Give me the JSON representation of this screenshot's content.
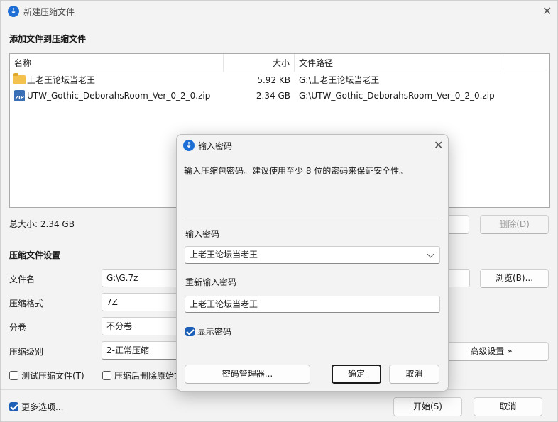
{
  "window": {
    "title": "新建压缩文件"
  },
  "files_section": {
    "title": "添加文件到压缩文件"
  },
  "file_list": {
    "columns": [
      "名称",
      "大小",
      "文件路径"
    ],
    "rows": [
      {
        "name": "上老王论坛当老王",
        "size": "5.92 KB",
        "path": "G:\\上老王论坛当老王",
        "icon": "folder-icon"
      },
      {
        "name": "UTW_Gothic_DeborahsRoom_Ver_0_2_0.zip",
        "size": "2.34 GB",
        "path": "G:\\UTW_Gothic_DeborahsRoom_Ver_0_2_0.zip",
        "icon": "zip-icon"
      }
    ]
  },
  "total_size": "总大小: 2.34 GB",
  "delete_button": "删除(D)",
  "settings": {
    "title": "压缩文件设置",
    "filename_label": "文件名",
    "filename_value": "G:\\G.7z",
    "browse_button": "浏览(B)...",
    "format_label": "压缩格式",
    "format_value": "7Z",
    "volume_label": "分卷",
    "volume_value": "不分卷",
    "level_label": "压缩级别",
    "level_value": "2-正常压缩",
    "advanced_button": "高级设置 »",
    "test_label": "测试压缩文件(T)",
    "delete_after_label": "压缩后删除原始文"
  },
  "footer": {
    "more_options": "更多选项...",
    "start_button": "开始(S)",
    "cancel_button": "取消"
  },
  "password_dialog": {
    "title": "输入密码",
    "description": "输入压缩包密码。建议使用至少 8 位的密码来保证安全性。",
    "password_label": "输入密码",
    "password_value": "上老王论坛当老王",
    "reenter_label": "重新输入密码",
    "reenter_value": "上老王论坛当老王",
    "show_password": "显示密码",
    "manager_button": "密码管理器...",
    "ok_button": "确定",
    "cancel_button": "取消"
  },
  "colors": {
    "accent": "#1c5fb6",
    "folder": "#f2c14e"
  }
}
